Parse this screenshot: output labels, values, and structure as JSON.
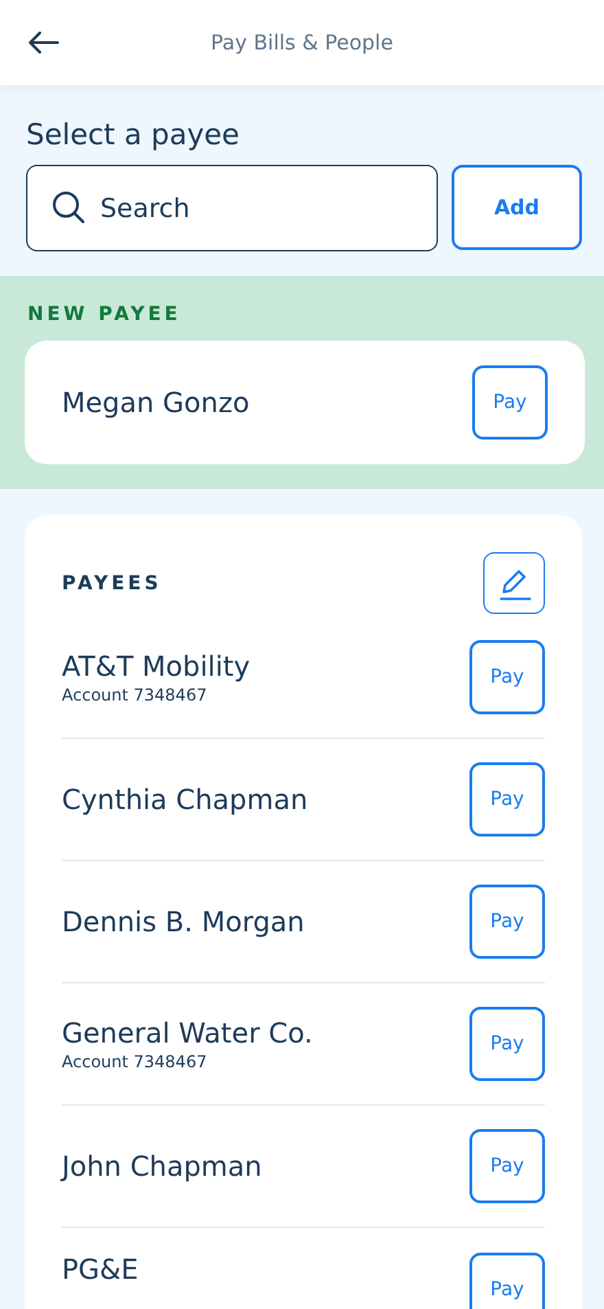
{
  "header": {
    "title": "Pay Bills & People"
  },
  "heading": "Select a payee",
  "search": {
    "placeholder": "Search"
  },
  "add_button": "Add",
  "new_payee": {
    "label": "NEW PAYEE",
    "name": "Megan Gonzo",
    "pay": "Pay"
  },
  "payees": {
    "label": "PAYEES",
    "items": [
      {
        "name": "AT&T Mobility",
        "account": "Account 7348467",
        "pay": "Pay"
      },
      {
        "name": "Cynthia Chapman",
        "pay": "Pay"
      },
      {
        "name": "Dennis B. Morgan",
        "pay": "Pay"
      },
      {
        "name": "General Water Co.",
        "account": "Account 7348467",
        "pay": "Pay"
      },
      {
        "name": "John Chapman",
        "pay": "Pay"
      },
      {
        "name": "PG&E",
        "pay": "Pay"
      }
    ]
  }
}
